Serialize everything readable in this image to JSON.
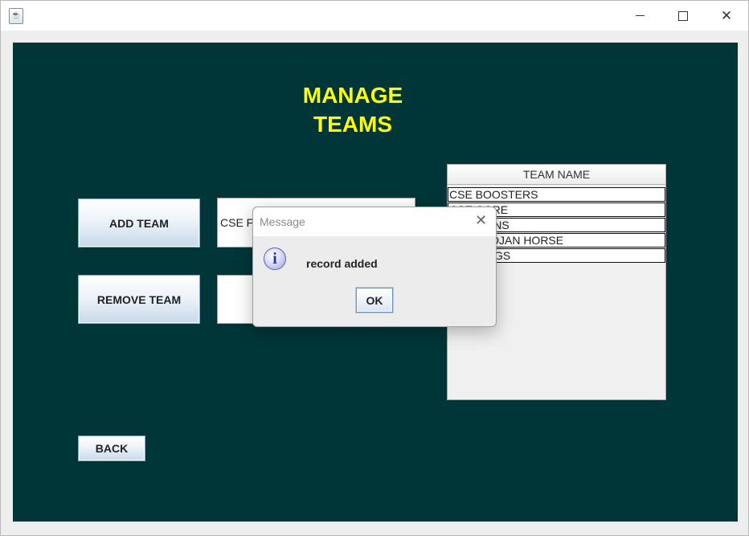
{
  "window": {
    "title": "",
    "app_icon": "java-cup-icon",
    "controls": {
      "minimize": "minimize-icon",
      "maximize": "maximize-icon",
      "close": "✕"
    }
  },
  "page": {
    "heading": "MANAGE TEAMS",
    "add_button": "ADD TEAM",
    "remove_button": "REMOVE TEAM",
    "back_button": "BACK",
    "team_name_field_value": "CSE FIGHTERS",
    "remove_field_value": ""
  },
  "table": {
    "header": "TEAM NAME",
    "rows": [
      "CSE BOOSTERS",
      "CSE CORE",
      "CSE LIONS",
      "CSE TROJAN HORSE",
      "CSE KINGS"
    ]
  },
  "dialog": {
    "title": "Message",
    "close": "✕",
    "icon": "i",
    "message": "record added",
    "ok_label": "OK"
  },
  "colors": {
    "panel_background": "#003638",
    "heading_color": "#ffff00"
  }
}
